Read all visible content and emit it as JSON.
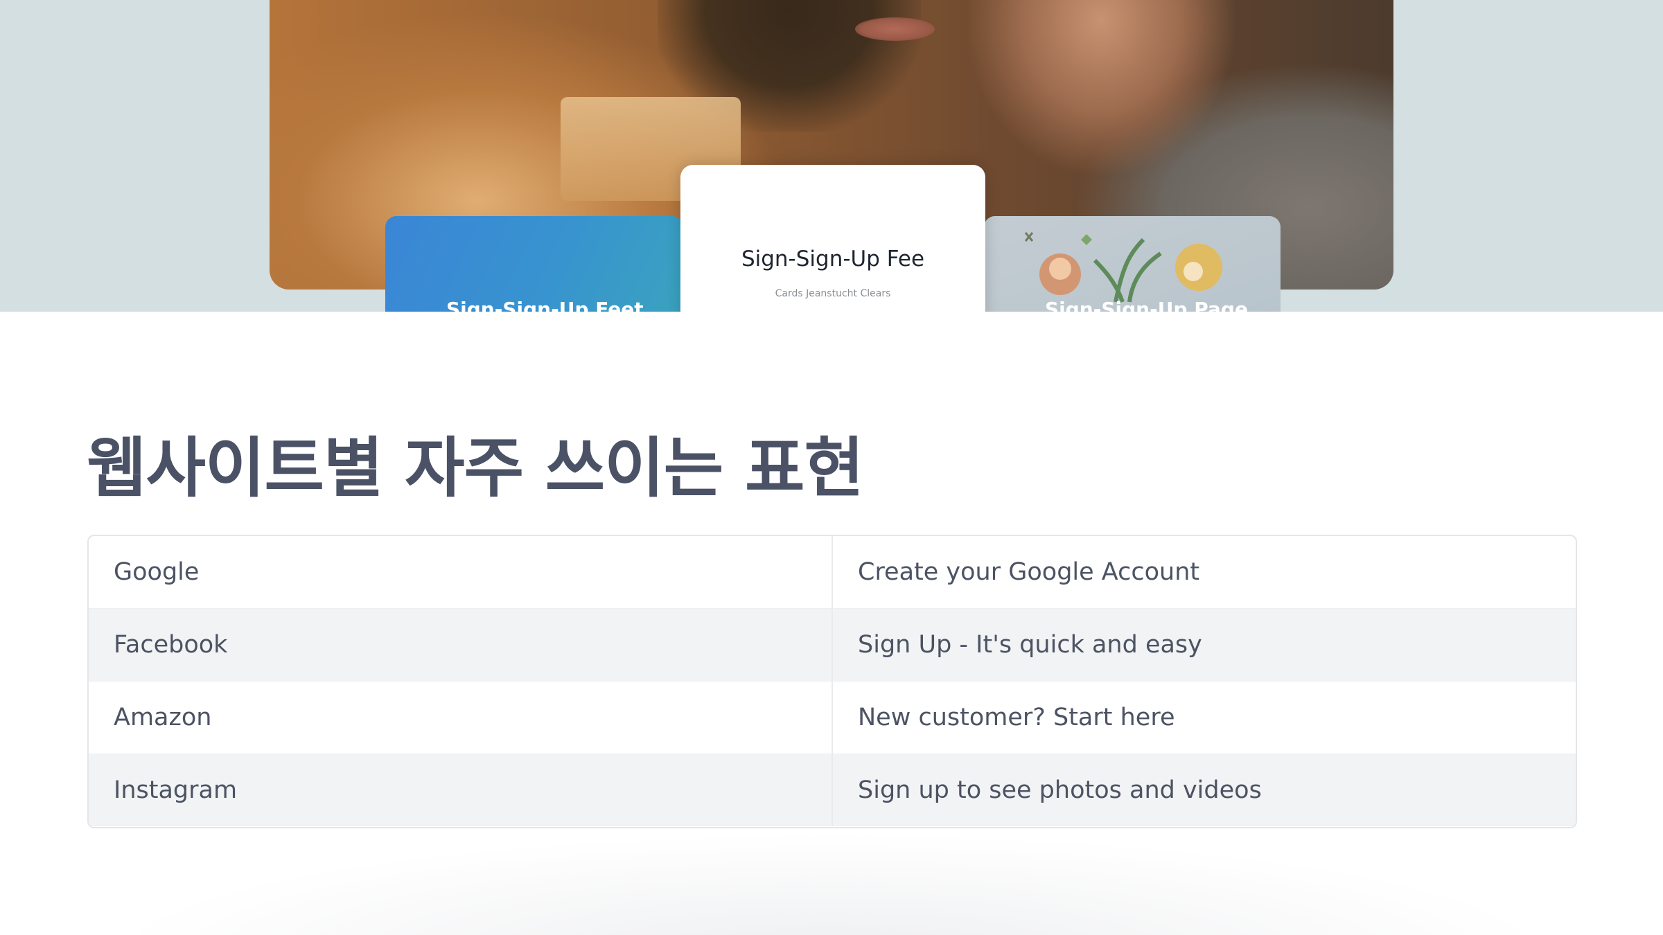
{
  "hero": {
    "card_left_text": "Sign-Sign-Up Feet",
    "card_center_title": "Sign-Sign-Up Fee",
    "card_center_sub": "Cards Jeanstucht Clears",
    "card_right_text": "Sign-Sign-Up Page"
  },
  "heading": "웹사이트별 자주 쓰이는 표현",
  "table": {
    "rows": [
      {
        "site": "Google",
        "phrase": "Create your Google Account"
      },
      {
        "site": "Facebook",
        "phrase": "Sign Up - It's quick and easy"
      },
      {
        "site": "Amazon",
        "phrase": "New customer? Start here"
      },
      {
        "site": "Instagram",
        "phrase": "Sign up to see photos and videos"
      }
    ]
  },
  "colors": {
    "heading": "#4b5266",
    "table_text": "#4c5363",
    "hero_bg": "#d3dfe1",
    "card_blue": "#3a86d6"
  }
}
